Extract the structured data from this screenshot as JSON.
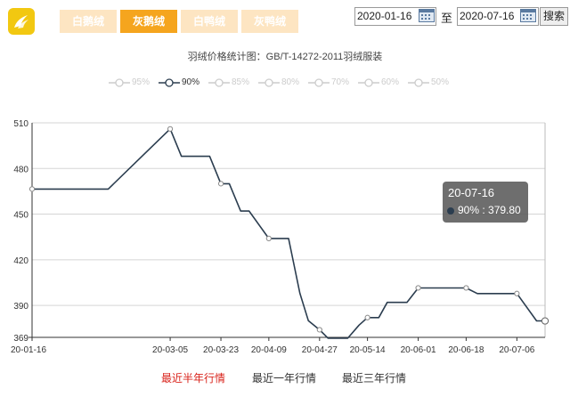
{
  "header": {
    "category_tabs": [
      {
        "label": "白鹅绒",
        "active": false
      },
      {
        "label": "灰鹅绒",
        "active": true
      },
      {
        "label": "白鸭绒",
        "active": false
      },
      {
        "label": "灰鸭绒",
        "active": false
      }
    ],
    "start_date": "2020-01-16",
    "end_date": "2020-07-16",
    "date_separator": "至",
    "search_label": "搜索"
  },
  "colors": {
    "tab_active": "#f5a51e",
    "tab_inactive": "#fde5c2",
    "line": "#2b3d4f",
    "active_period": "#d9241c",
    "logo": "#f2c811"
  },
  "chart_data": {
    "type": "line",
    "title": "羽绒价格统计图：GB/T-14272-2011羽绒服装",
    "legend": [
      "95%",
      "90%",
      "85%",
      "80%",
      "70%",
      "60%",
      "50%"
    ],
    "active_series": "90%",
    "legend_placement": "top-center",
    "grid": true,
    "ylim": [
      369,
      510
    ],
    "y_ticks": [
      369,
      390,
      420,
      450,
      480,
      510
    ],
    "x_labels": [
      "20-01-16",
      "20-03-05",
      "20-03-23",
      "20-04-09",
      "20-04-27",
      "20-05-14",
      "20-06-01",
      "20-06-18",
      "20-07-06"
    ],
    "series": [
      {
        "name": "90%",
        "x": [
          "20-01-16",
          "20-02-12",
          "20-02-24",
          "20-03-05",
          "20-03-09",
          "20-03-19",
          "20-03-23",
          "20-03-26",
          "20-03-30",
          "20-04-02",
          "20-04-09",
          "20-04-16",
          "20-04-20",
          "20-04-23",
          "20-04-27",
          "20-04-30",
          "20-05-07",
          "20-05-11",
          "20-05-14",
          "20-05-18",
          "20-05-21",
          "20-05-28",
          "20-06-01",
          "20-06-18",
          "20-06-22",
          "20-07-06",
          "20-07-13",
          "20-07-16"
        ],
        "y": [
          466.5,
          466.5,
          488,
          506,
          488,
          488,
          470,
          470,
          452,
          452,
          434,
          434,
          398,
          380,
          374,
          368.5,
          368.5,
          377,
          382,
          382,
          392,
          392,
          401.5,
          401.5,
          397.8,
          397.8,
          379.8,
          379.8
        ],
        "markers": [
          0,
          3,
          6,
          10,
          14,
          18,
          22,
          23,
          25,
          27
        ]
      }
    ],
    "tooltip": {
      "date": "20-07-16",
      "label": "90% : 379.80"
    }
  },
  "footer": {
    "periods": [
      {
        "label": "最近半年行情",
        "active": true
      },
      {
        "label": "最近一年行情",
        "active": false
      },
      {
        "label": "最近三年行情",
        "active": false
      }
    ]
  }
}
